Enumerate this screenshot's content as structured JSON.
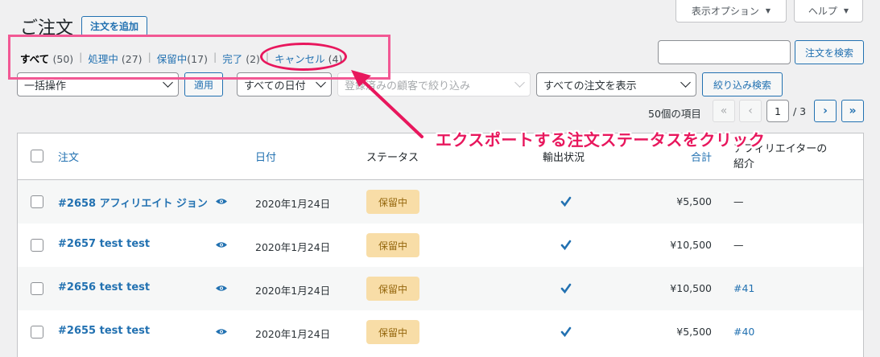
{
  "header": {
    "title": "ご注文",
    "add_button": "注文を追加",
    "screen_options": "表示オプション",
    "help": "ヘルプ"
  },
  "views": [
    {
      "label": "すべて",
      "count": "(50)",
      "current": true
    },
    {
      "label": "処理中",
      "count": "(27)"
    },
    {
      "label": "保留中",
      "count": "(17)"
    },
    {
      "label": "完了",
      "count": "(2)"
    },
    {
      "label": "キャンセル",
      "count": "(4)"
    }
  ],
  "search": {
    "value": "",
    "button": "注文を検索"
  },
  "filters": {
    "bulk_action": "一括操作",
    "apply": "適用",
    "all_dates": "すべての日付",
    "customer_placeholder": "登録済みの顧客で絞り込み",
    "all_orders": "すべての注文を表示",
    "filter_button": "絞り込み検索"
  },
  "pagination": {
    "items": "50個の項目",
    "first": "«",
    "prev": "‹",
    "current_page": "1",
    "of_total": "/ 3",
    "next": "›",
    "last": "»"
  },
  "table": {
    "headers": {
      "order": "注文",
      "date": "日付",
      "status": "ステータス",
      "shipping": "輸出状況",
      "total": "合計",
      "referral_line1": "アフィリエイターの",
      "referral_line2": "紹介"
    },
    "rows": [
      {
        "order": "#2658 アフィリエイト ジョン",
        "date": "2020年1月24日",
        "status": "保留中",
        "total": "¥5,500",
        "referral": "—"
      },
      {
        "order": "#2657 test test",
        "date": "2020年1月24日",
        "status": "保留中",
        "total": "¥10,500",
        "referral": "—"
      },
      {
        "order": "#2656 test test",
        "date": "2020年1月24日",
        "status": "保留中",
        "total": "¥10,500",
        "referral": "#41"
      },
      {
        "order": "#2655 test test",
        "date": "2020年1月24日",
        "status": "保留中",
        "total": "¥5,500",
        "referral": "#40"
      }
    ]
  },
  "annotation": {
    "text": "エクスポートする注文ステータスをクリック",
    "color": "#e8175d",
    "box_color": "#f25894"
  },
  "colors": {
    "link": "#2271b1",
    "badge_bg": "#f8dda7",
    "badge_text": "#94660c"
  }
}
